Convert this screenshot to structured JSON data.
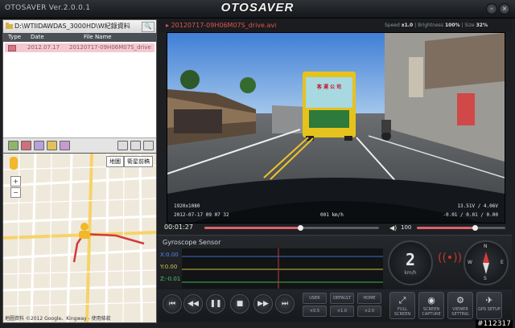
{
  "app": {
    "version_title": "OTOSAVER Ver.2.0.0.1",
    "brand": "OTOSAVER"
  },
  "window_controls": {
    "minimize": "-",
    "close": "×"
  },
  "file_panel": {
    "path": "D:\\WTIIDAWDAS_3000HD\\W紀錄資料",
    "columns": {
      "type": "Type",
      "date": "Date",
      "file_name": "File Name"
    },
    "rows": [
      {
        "date": "2012.07.17",
        "file_name": "20120717-09H06M07S_drive"
      }
    ]
  },
  "map": {
    "tab_map": "地圖",
    "tab_satellite": "衛星前稿",
    "credit": "地圖資料 ©2012 Google、Kingway - 使用條款"
  },
  "video": {
    "file_name": "20120717-09H06M07S_drive.avi",
    "speed_label": "Speed",
    "speed_value": "x1.0",
    "brightness_label": "Brightness",
    "brightness_value": "100%",
    "size_label": "Size",
    "size_value": "32%",
    "overlay_resolution": "1920x1080",
    "overlay_datetime": "2012-07-17 09 07 32",
    "overlay_speed": "001 km/h",
    "overlay_voltage": "13.51V / 4.06V",
    "overlay_gps": "-0.01 / 0.01 / 0.00",
    "bus_sign": "客 運 公 司"
  },
  "timeline": {
    "time": "00:01:27",
    "progress": 0.55,
    "volume": "100",
    "volume_level": 0.65
  },
  "gyro": {
    "title": "Gyroscope Sensor",
    "x_label": "X:0.00",
    "y_label": "Y:0.00",
    "z_label": "Z:-0.01",
    "speed": "2",
    "speed_unit": "km/h",
    "compass": {
      "n": "N",
      "s": "S",
      "e": "E",
      "w": "W"
    }
  },
  "controls": {
    "small": {
      "a1": "USER",
      "a2": "×0.5",
      "b1": "DEFAULT",
      "b2": "×1.0",
      "c1": "HOME",
      "c2": "×2.0"
    },
    "big": {
      "full": "FULL SCREEN",
      "capture": "SCREEN CAPTURE",
      "viewer": "VIEWER SETTING",
      "gps": "GPS SETUP"
    }
  },
  "watermark": "#112317",
  "colors": {
    "accent": "#d9646d",
    "bus": "#e6c21d",
    "background": "#1d1f22"
  }
}
